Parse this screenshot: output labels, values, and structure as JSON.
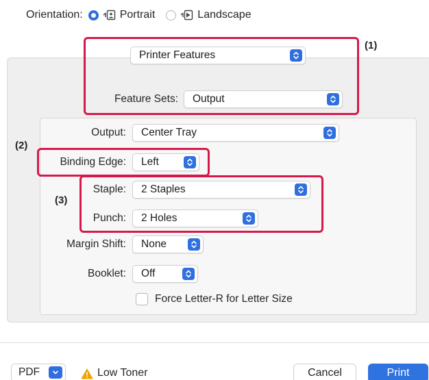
{
  "orientation": {
    "label": "Orientation:",
    "portrait": "Portrait",
    "landscape": "Landscape",
    "selected": "Portrait"
  },
  "printer_features": {
    "value": "Printer Features"
  },
  "feature_sets": {
    "label": "Feature Sets:",
    "value": "Output"
  },
  "output": {
    "label": "Output:",
    "value": "Center Tray"
  },
  "binding_edge": {
    "label": "Binding Edge:",
    "value": "Left"
  },
  "staple": {
    "label": "Staple:",
    "value": "2 Staples"
  },
  "punch": {
    "label": "Punch:",
    "value": "2 Holes"
  },
  "margin_shift": {
    "label": "Margin Shift:",
    "value": "None"
  },
  "booklet": {
    "label": "Booklet:",
    "value": "Off"
  },
  "force_letter_r": {
    "label": "Force Letter-R for Letter Size",
    "checked": false
  },
  "callouts": {
    "c1": "(1)",
    "c2": "(2)",
    "c3": "(3)"
  },
  "footer": {
    "pdf_label": "PDF",
    "status": "Low Toner",
    "cancel_label": "Cancel",
    "print_label": "Print"
  },
  "colors": {
    "accent": "#2f6fdf",
    "highlight": "#d4194a",
    "warning": "#f2a300"
  },
  "icons": [
    "portrait-orientation-icon",
    "landscape-orientation-icon",
    "popup-stepper-icon",
    "chevron-down-icon",
    "warning-icon"
  ]
}
